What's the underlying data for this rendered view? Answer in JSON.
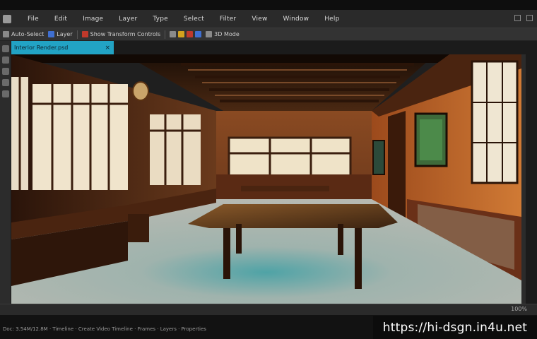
{
  "menubar": {
    "items": [
      "File",
      "Edit",
      "Image",
      "Layer",
      "Type",
      "Select",
      "Filter",
      "View",
      "Window",
      "Help"
    ]
  },
  "optionsbar": {
    "items": [
      "Auto-Select",
      "Layer",
      "Show Transform Controls",
      "3D Mode"
    ]
  },
  "document": {
    "tab_label": "Interior Render.psd",
    "close_glyph": "×"
  },
  "statusbar": {
    "zoom": "100%"
  },
  "timeline": {
    "text": "Doc: 3.54M/12.8M  ·  Timeline  ·  Create Video Timeline  ·  Frames  ·  Layers  ·  Properties"
  },
  "watermark": {
    "text": "https://hi-dsgn.in4u.net"
  },
  "colors": {
    "tab_accent": "#22a3c4",
    "wall_orange": "#c8662a",
    "wood_dark": "#3a1e0e",
    "floor": "#a9b3ad"
  },
  "icons": [
    "app-icon",
    "close-icon",
    "minimize-icon",
    "maximize-icon"
  ]
}
